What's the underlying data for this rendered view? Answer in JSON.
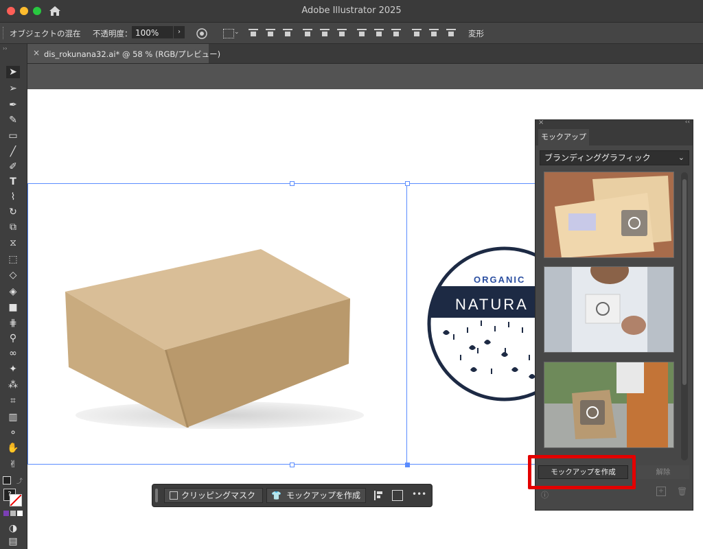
{
  "window": {
    "title": "Adobe Illustrator 2025"
  },
  "control_bar": {
    "object_label": "オブジェクトの混在",
    "opacity_label": "不透明度：",
    "opacity_value": "100%",
    "transform_label": "変形"
  },
  "document": {
    "tab_label": "dis_rokunana32.ai* @ 58 % (RGB/プレビュー)"
  },
  "logo": {
    "line1": "ORGANIC",
    "line2": "NATURA"
  },
  "mockup_panel": {
    "tab": "モックアップ",
    "category": "ブランディンググラフィック",
    "create_button": "モックアップを作成",
    "release_button": "解除"
  },
  "context_bar": {
    "clip_button": "クリッピングマスク",
    "mockup_button": "モックアップを作成",
    "more": "•••"
  },
  "colors": {
    "selection": "#5a8cff",
    "highlight": "#e30000"
  }
}
